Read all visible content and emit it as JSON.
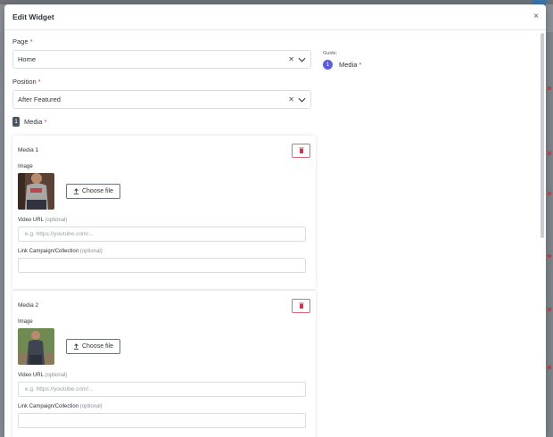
{
  "modal": {
    "title": "Edit Widget",
    "close_symbol": "×"
  },
  "fields": {
    "page": {
      "label": "Page",
      "required_mark": "*",
      "value": "Home"
    },
    "position": {
      "label": "Position",
      "required_mark": "*",
      "value": "After Featured"
    },
    "clear_symbol": "✕"
  },
  "media_section": {
    "step_number": "1",
    "label": "Media",
    "required_mark": "*"
  },
  "media_items": [
    {
      "title": "Media 1",
      "image_label": "Image",
      "choose_file_label": "Choose file",
      "video_url_label": "Video URL",
      "video_url_optional": "(optional)",
      "video_url_placeholder": "e.g. https://youtube.com/...",
      "link_label": "Link Campaign/Collection",
      "link_optional": "(optional)",
      "link_value": ""
    },
    {
      "title": "Media 2",
      "image_label": "Image",
      "choose_file_label": "Choose file",
      "video_url_label": "Video URL",
      "video_url_optional": "(optional)",
      "video_url_placeholder": "e.g. https://youtube.com/...",
      "link_label": "Link Campaign/Collection",
      "link_optional": "(optional)",
      "link_value": ""
    }
  ],
  "guide": {
    "label": "Guide:",
    "items": [
      {
        "number": "1",
        "label": "Media",
        "required_mark": "*"
      }
    ]
  },
  "icons": {
    "delete": "trash-icon",
    "upload": "upload-icon",
    "dropdown": "chevron-down-icon",
    "clear": "clear-icon",
    "close": "close-icon"
  },
  "colors": {
    "required": "#d2334a",
    "delete_border": "#e0677a",
    "guide_badge": "#5d5fd6",
    "step_badge": "#4a5563"
  }
}
